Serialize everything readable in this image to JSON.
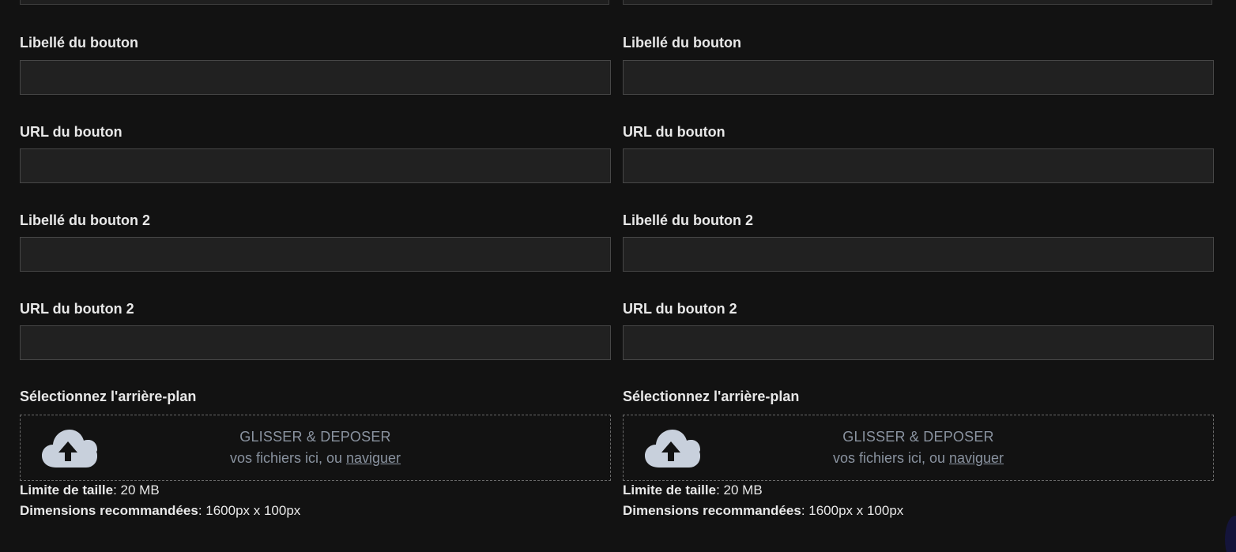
{
  "columns": [
    {
      "fields": [
        {
          "label": "Libellé du bouton",
          "value": "",
          "placeholder": ""
        },
        {
          "label": "URL du bouton",
          "value": "",
          "placeholder": ""
        },
        {
          "label": "Libellé du bouton 2",
          "value": "",
          "placeholder": ""
        },
        {
          "label": "URL du bouton 2",
          "value": "",
          "placeholder": ""
        }
      ],
      "background": {
        "label": "Sélectionnez l'arrière-plan",
        "dropzone": {
          "title": "GLISSER & DEPOSER",
          "sub_prefix": "vos fichiers ici, ou ",
          "browse_link": "naviguer",
          "icon": "cloud-upload-icon"
        },
        "size_limit_label": "Limite de taille",
        "size_limit_value": ": 20 MB",
        "dimensions_label": "Dimensions recommandées",
        "dimensions_value": ": 1600px x 100px"
      }
    },
    {
      "fields": [
        {
          "label": "Libellé du bouton",
          "value": "",
          "placeholder": ""
        },
        {
          "label": "URL du bouton",
          "value": "",
          "placeholder": ""
        },
        {
          "label": "Libellé du bouton 2",
          "value": "",
          "placeholder": ""
        },
        {
          "label": "URL du bouton 2",
          "value": "",
          "placeholder": ""
        }
      ],
      "background": {
        "label": "Sélectionnez l'arrière-plan",
        "dropzone": {
          "title": "GLISSER & DEPOSER",
          "sub_prefix": "vos fichiers ici, ou ",
          "browse_link": "naviguer",
          "icon": "cloud-upload-icon"
        },
        "size_limit_label": "Limite de taille",
        "size_limit_value": ": 20 MB",
        "dimensions_label": "Dimensions recommandées",
        "dimensions_value": ": 1600px x 100px"
      }
    }
  ],
  "colors": {
    "background": "#121212",
    "input_bg": "#212121",
    "input_border": "#474747",
    "label_text": "#e8e8e8",
    "dropzone_text": "#8a93a0",
    "icon_fill": "#c8d0dc"
  }
}
